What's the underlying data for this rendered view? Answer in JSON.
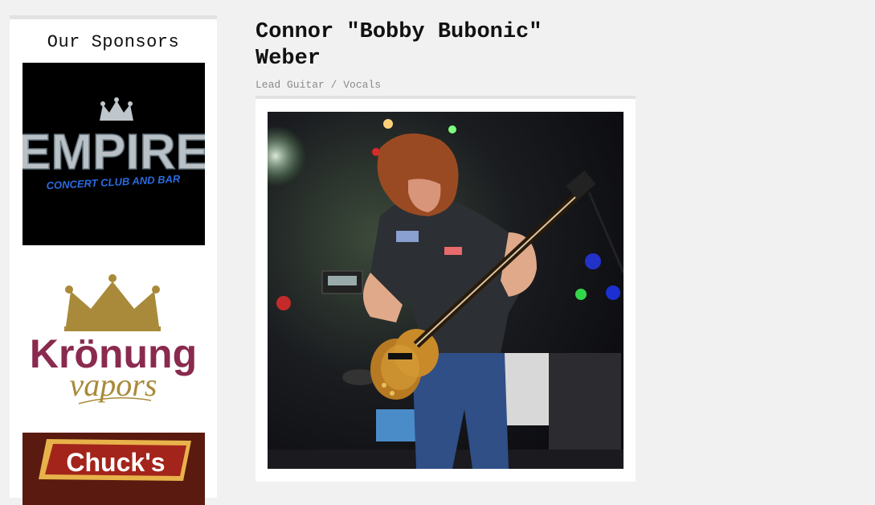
{
  "sidebar": {
    "heading": "Our Sponsors",
    "sponsors": [
      {
        "logo_title": "EMPIRE",
        "logo_subtitle": "CONCERT CLUB AND BAR",
        "icon": "crown-icon",
        "color": "#1f5fcf"
      },
      {
        "logo_title": "Krönung",
        "logo_subtitle": "vapors",
        "icon": "crown-icon",
        "color": "#8a2a4f",
        "accent": "#a88a3a"
      },
      {
        "logo_title": "Chuck's",
        "icon": "sign-banner",
        "color": "#5a1a10"
      }
    ]
  },
  "member": {
    "name": "Connor \"Bobby Bubonic\" Weber",
    "role": "Lead Guitar / Vocals",
    "photo": "guitarist-on-stage-photo"
  }
}
